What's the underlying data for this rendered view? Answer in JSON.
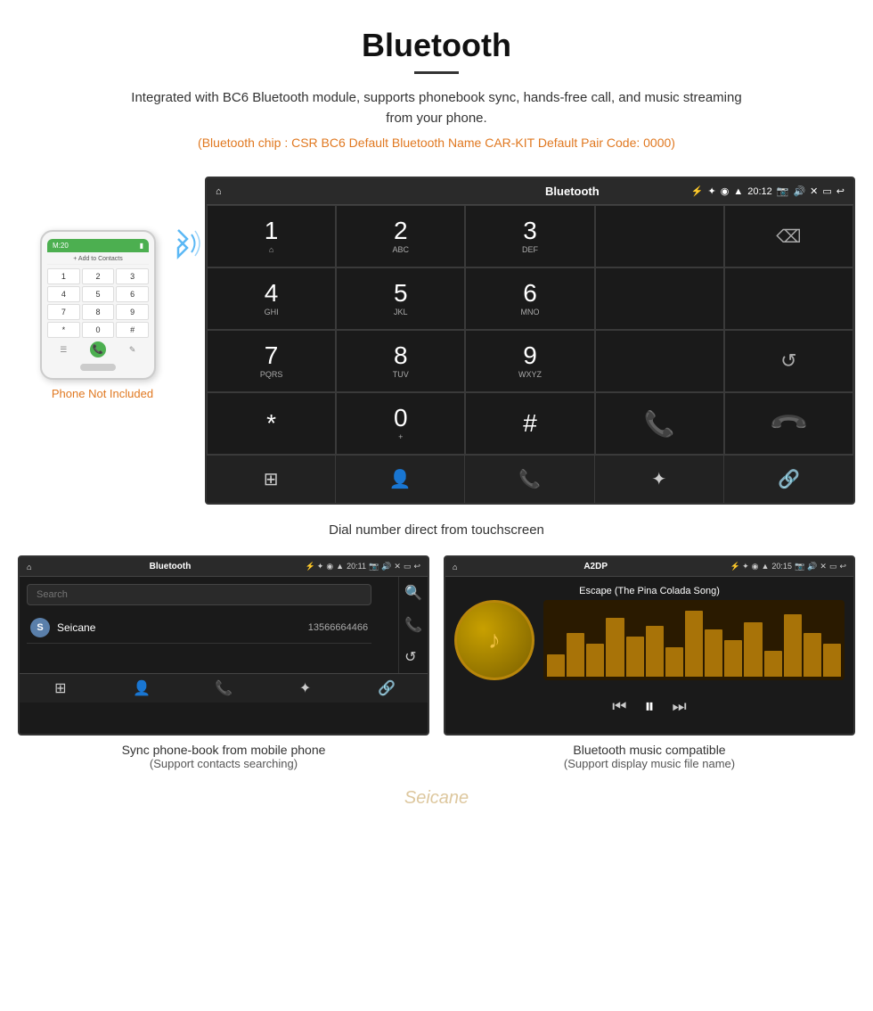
{
  "header": {
    "title": "Bluetooth",
    "description": "Integrated with BC6 Bluetooth module, supports phonebook sync, hands-free call, and music streaming from your phone.",
    "specs": "(Bluetooth chip : CSR BC6   Default Bluetooth Name CAR-KIT   Default Pair Code: 0000)"
  },
  "phone_mockup": {
    "not_included": "Phone Not Included",
    "status": "M:20",
    "add_contacts": "+ Add to Contacts",
    "keys": [
      "1",
      "2",
      "3",
      "4",
      "5",
      "6",
      "7",
      "8",
      "9",
      "*",
      "0",
      "#"
    ]
  },
  "large_screen": {
    "title": "Bluetooth",
    "time": "20:12",
    "caption": "Dial number direct from touchscreen",
    "dialpad": [
      {
        "number": "1",
        "letters": "⌂"
      },
      {
        "number": "2",
        "letters": "ABC"
      },
      {
        "number": "3",
        "letters": "DEF"
      },
      {
        "number": "",
        "letters": ""
      },
      {
        "number": "⌫",
        "letters": ""
      },
      {
        "number": "4",
        "letters": "GHI"
      },
      {
        "number": "5",
        "letters": "JKL"
      },
      {
        "number": "6",
        "letters": "MNO"
      },
      {
        "number": "",
        "letters": ""
      },
      {
        "number": "",
        "letters": ""
      },
      {
        "number": "7",
        "letters": "PQRS"
      },
      {
        "number": "8",
        "letters": "TUV"
      },
      {
        "number": "9",
        "letters": "WXYZ"
      },
      {
        "number": "",
        "letters": ""
      },
      {
        "number": "↺",
        "letters": ""
      },
      {
        "number": "*",
        "letters": ""
      },
      {
        "number": "0",
        "letters": "+"
      },
      {
        "number": "#",
        "letters": ""
      },
      {
        "number": "📞",
        "letters": "call"
      },
      {
        "number": "📵",
        "letters": "end"
      }
    ]
  },
  "phonebook_screen": {
    "title": "Bluetooth",
    "time": "20:11",
    "search_placeholder": "Search",
    "contact": {
      "initial": "S",
      "name": "Seicane",
      "number": "13566664466"
    },
    "caption_main": "Sync phone-book from mobile phone",
    "caption_sub": "(Support contacts searching)"
  },
  "music_screen": {
    "title": "A2DP",
    "time": "20:15",
    "song_title": "Escape (The Pina Colada Song)",
    "caption_main": "Bluetooth music compatible",
    "caption_sub": "(Support display music file name)"
  },
  "colors": {
    "accent_orange": "#e07820",
    "screen_bg": "#1a1a1a",
    "screen_bar": "#2a2a2a",
    "call_green": "#4caf50",
    "call_red": "#f44336",
    "bluetooth_blue": "#5bb8f5"
  }
}
